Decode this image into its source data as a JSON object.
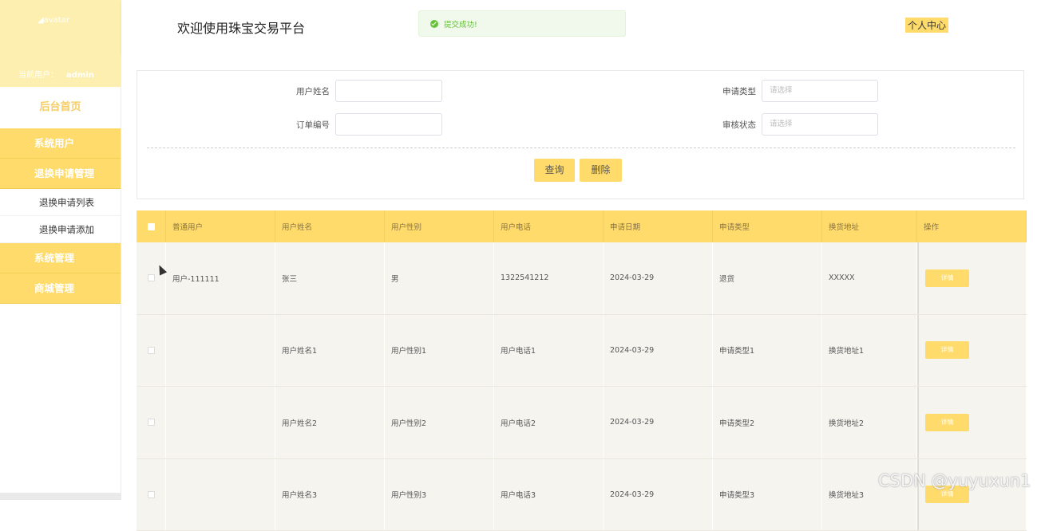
{
  "sidebar": {
    "avatar_alt": "avatar",
    "current_user_label": "当前用户：",
    "current_user": "admin",
    "home": "后台首页",
    "groups": [
      {
        "label": "系统用户"
      },
      {
        "label": "退换申请管理",
        "items": [
          "退换申请列表",
          "退换申请添加"
        ]
      },
      {
        "label": "系统管理"
      },
      {
        "label": "商城管理"
      }
    ]
  },
  "header": {
    "title": "欢迎使用珠宝交易平台",
    "toast": "提交成功!",
    "personal_center": "个人中心"
  },
  "search": {
    "user_name_label": "用户姓名",
    "user_name_value": "",
    "apply_type_label": "申请类型",
    "apply_type_placeholder": "请选择",
    "order_no_label": "订单编号",
    "order_no_value": "",
    "audit_status_label": "审核状态",
    "audit_status_placeholder": "请选择",
    "query_button": "查询",
    "delete_button": "删除"
  },
  "table": {
    "columns": [
      "普通用户",
      "用户姓名",
      "用户性别",
      "用户电话",
      "申请日期",
      "申请类型",
      "换货地址",
      "操作"
    ],
    "rows": [
      [
        "用户-111111",
        "张三",
        "男",
        "1322541212",
        "2024-03-29",
        "退货",
        "XXXXX"
      ],
      [
        "",
        "用户姓名1",
        "用户性别1",
        "用户电话1",
        "2024-03-29",
        "申请类型1",
        "换货地址1"
      ],
      [
        "",
        "用户姓名2",
        "用户性别2",
        "用户电话2",
        "2024-03-29",
        "申请类型2",
        "换货地址2"
      ],
      [
        "",
        "用户姓名3",
        "用户性别3",
        "用户电话3",
        "2024-03-29",
        "申请类型3",
        "换货地址3"
      ]
    ],
    "detail_label": "详情"
  },
  "watermark": "CSDN @yuyuxun1",
  "colors": {
    "accent": "#fedb6b",
    "sidebar_head": "#fdefaf",
    "success": "#67c23a"
  }
}
